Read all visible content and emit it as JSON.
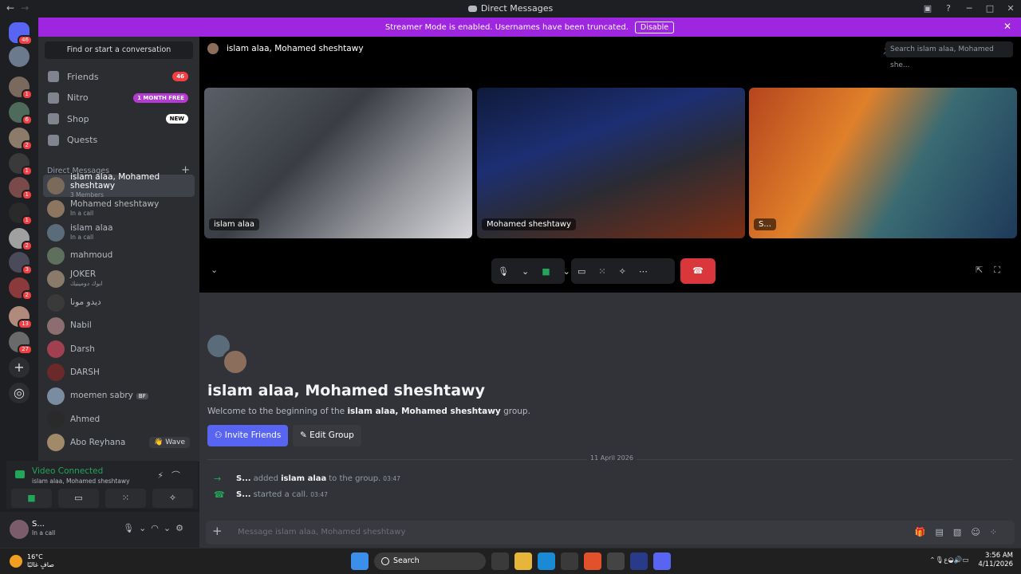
{
  "window": {
    "title": "Direct Messages"
  },
  "banner": {
    "text": "Streamer Mode is enabled. Usernames have been truncated.",
    "button": "Disable"
  },
  "servers": [
    {
      "badge": "46",
      "color": "#5865f2"
    },
    {
      "badge": "",
      "color": "#6b7a8c"
    },
    {
      "badge": "1",
      "color": "#7a6a5e"
    },
    {
      "badge": "6",
      "color": "#4d6a5a"
    },
    {
      "badge": "2",
      "color": "#8c7a6a"
    },
    {
      "badge": "1",
      "color": "#3a3a3a"
    },
    {
      "badge": "1",
      "color": "#7a4a4a"
    },
    {
      "badge": "1",
      "color": "#2a2a2a"
    },
    {
      "badge": "2",
      "color": "#a0a0a0"
    },
    {
      "badge": "3",
      "color": "#4a4a5a"
    },
    {
      "badge": "2",
      "color": "#8a3a3a"
    },
    {
      "badge": "13",
      "color": "#b08a7a"
    },
    {
      "badge": "27",
      "color": "#6a6a6a"
    }
  ],
  "sidebar": {
    "find": "Find or start a conversation",
    "nav": [
      {
        "label": "Friends",
        "pill": "46",
        "pill_color": "#f23f43"
      },
      {
        "label": "Nitro",
        "pill": "1 MONTH FREE",
        "pill_color": "#b53ad1"
      },
      {
        "label": "Shop",
        "pill": "NEW",
        "pill_color": "#ffffff"
      },
      {
        "label": "Quests",
        "pill": "",
        "pill_color": ""
      }
    ],
    "dm_header": "Direct Messages",
    "dms": [
      {
        "name": "islam alaa, Mohamed sheshtawy",
        "status": "3 Members",
        "color": "#7a6a5a",
        "active": true
      },
      {
        "name": "Mohamed sheshtawy",
        "status": "In a call",
        "color": "#8c7660"
      },
      {
        "name": "islam alaa",
        "status": "In a call",
        "color": "#5a6b7a"
      },
      {
        "name": "mahmoud",
        "status": "",
        "color": "#5e6f5e"
      },
      {
        "name": "JOKER",
        "status": "ابوك دومينيك",
        "color": "#8a7a6a"
      },
      {
        "name": "ديدو مونا",
        "status": "",
        "color": "#3a3a3a"
      },
      {
        "name": "Nabil",
        "status": "",
        "color": "#8c6e6e"
      },
      {
        "name": "Darsh",
        "status": "",
        "color": "#a04050"
      },
      {
        "name": "DARSH",
        "status": "",
        "color": "#6a2a2a"
      },
      {
        "name": "moemen sabry",
        "status": "",
        "color": "#7a8ca0",
        "extra": "BF"
      },
      {
        "name": "Ahmed",
        "status": "",
        "color": "#2a2a2a"
      },
      {
        "name": "Abo Reyhana",
        "status": "",
        "color": "#a08a6a",
        "wave": "Wave"
      }
    ]
  },
  "voice": {
    "status": "Video Connected",
    "channel": "islam alaa, Mohamed sheshtawy"
  },
  "user": {
    "name": "S...",
    "status": "In a call"
  },
  "header": {
    "title": "islam alaa, Mohamed sheshtawy",
    "search_placeholder": "Search islam alaa, Mohamed she..."
  },
  "tiles": [
    {
      "name": "islam alaa"
    },
    {
      "name": "Mohamed sheshtawy"
    },
    {
      "name": "S..."
    }
  ],
  "chat": {
    "title": "islam alaa, Mohamed sheshtawy",
    "desc_pre": "Welcome to the beginning of the ",
    "desc_bold": "islam alaa, Mohamed sheshtawy",
    "desc_post": " group.",
    "invite": "Invite Friends",
    "edit": "Edit Group",
    "date": "11 April 2026",
    "messages": [
      {
        "user": "S...",
        "pre": "added",
        "bold": "islam alaa",
        "post": "to the group.",
        "time": "03:47"
      },
      {
        "user": "S...",
        "pre": "started a call.",
        "bold": "",
        "post": "",
        "time": "03:47"
      }
    ],
    "composer_placeholder": "Message islam alaa, Mohamed sheshtawy"
  },
  "taskbar": {
    "temp": "16°C",
    "weather": "صافٍ غالبًا",
    "search": "Search",
    "time": "3:56 AM",
    "date": "4/11/2026",
    "lang": "ع"
  }
}
